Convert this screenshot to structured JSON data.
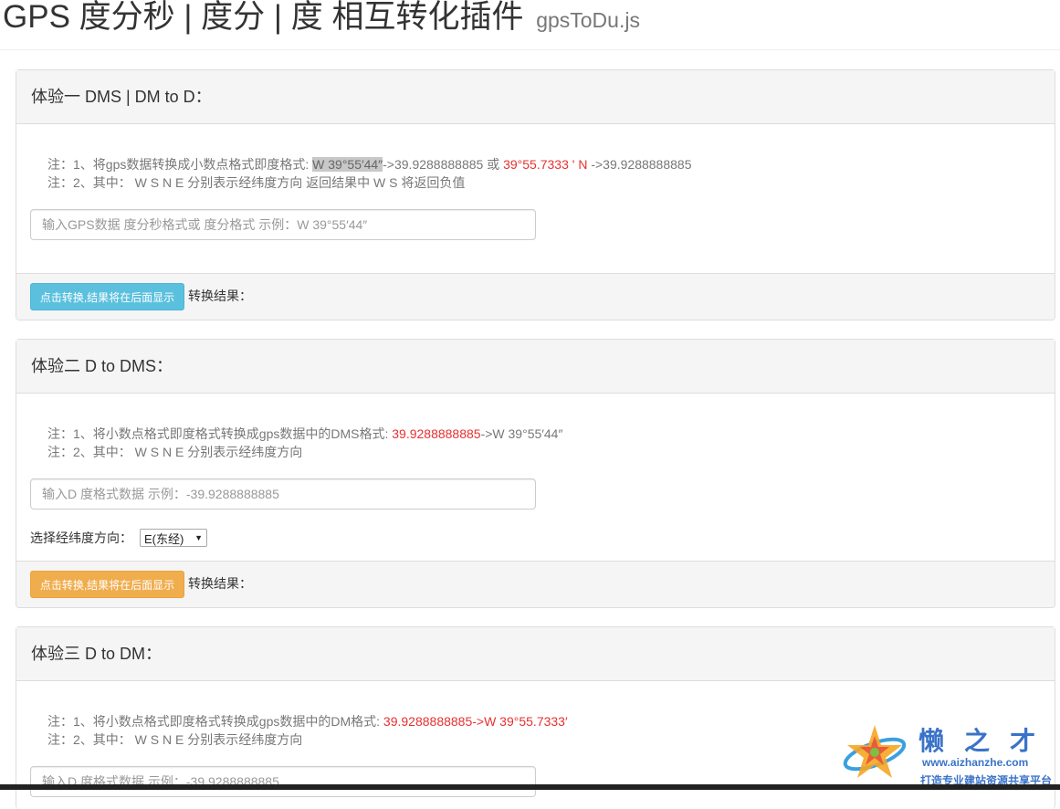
{
  "header": {
    "title": "GPS 度分秒 | 度分 | 度 相互转化插件",
    "subtitle": "gpsToDu.js"
  },
  "panels": [
    {
      "heading": "体验一 DMS | DM to D：",
      "note1_prefix": "注：1、将gps数据转换成小数点格式即度格式: ",
      "note1_highlight": "W 39°55′44″",
      "note1_mid": "->39.9288888885 或 ",
      "note1_red": "39°55.7333 ' N",
      "note1_suffix": " ->39.9288888885",
      "note2": "注：2、其中： W S N E 分别表示经纬度方向 返回结果中 W S 将返回负值",
      "input_placeholder": "输入GPS数据 度分秒格式或 度分格式 示例：W 39°55′44″",
      "button_label": "点击转换,结果将在后面显示",
      "result_label": "转换结果："
    },
    {
      "heading": "体验二 D to DMS：",
      "note1_prefix": "注：1、将小数点格式即度格式转换成gps数据中的DMS格式: ",
      "note1_red": "39.9288888885",
      "note1_suffix": "->W 39°55′44″",
      "note2": "注：2、其中： W S N E 分别表示经纬度方向",
      "input_placeholder": "输入D 度格式数据 示例：-39.9288888885",
      "direction_label": "选择经纬度方向：",
      "direction_value": "E(东经)",
      "button_label": "点击转换,结果将在后面显示",
      "result_label": "转换结果："
    },
    {
      "heading": "体验三 D to DM：",
      "note1_prefix": "注：1、将小数点格式即度格式转换成gps数据中的DM格式: ",
      "note1_red": "39.9288888885->W 39°55.7333′",
      "note2": "注：2、其中： W S N E 分别表示经纬度方向",
      "input_placeholder": "输入D 度格式数据 示例：-39.9288888885"
    }
  ],
  "watermark": {
    "name": "懒之才",
    "url": "www.aizhanzhe.com",
    "slogan": "打造专业建站资源共享平台"
  },
  "colors": {
    "info_button": "#5bc0de",
    "warning_button": "#f0ad4e",
    "note_red": "#e83030",
    "watermark_blue": "#3a73c8"
  }
}
